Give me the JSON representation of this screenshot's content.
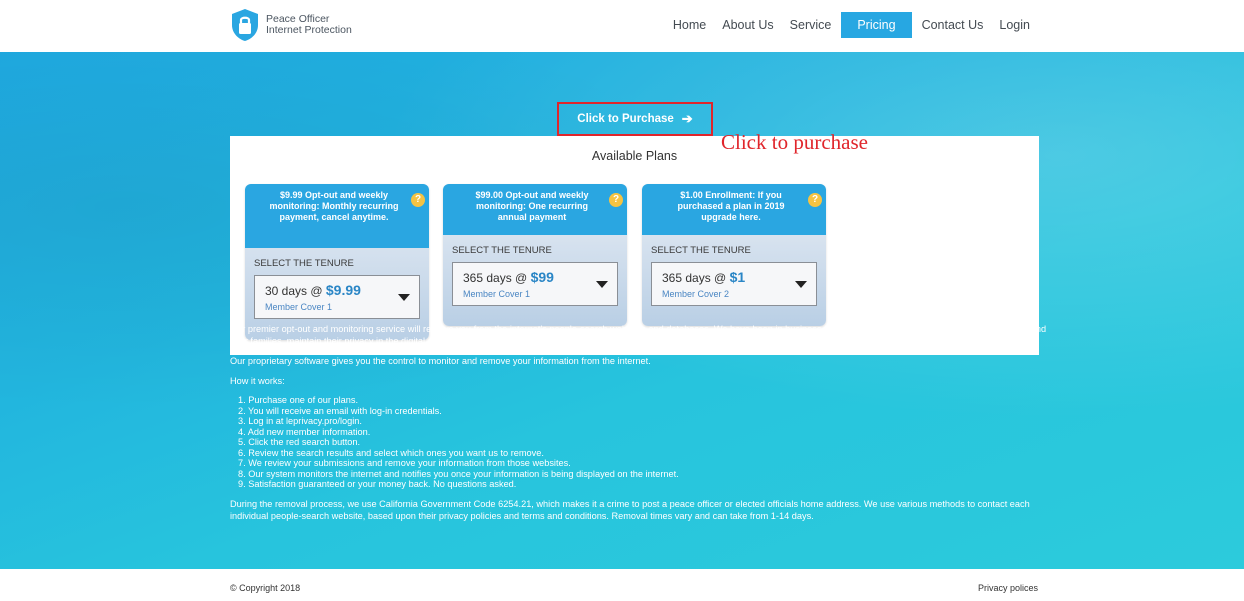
{
  "header": {
    "logo_line1": "Peace Officer",
    "logo_line2": "Internet Protection",
    "nav": [
      "Home",
      "About Us",
      "Service",
      "Pricing",
      "Contact Us",
      "Login"
    ],
    "active_nav": "Pricing"
  },
  "purchase": {
    "label": "Click to Purchase",
    "arrow": "➔",
    "annotation": "Click to purchase"
  },
  "plans": {
    "title": "Available Plans",
    "tenure_label": "SELECT THE TENURE",
    "help": "?",
    "items": [
      {
        "header": "$9.99 Opt-out and weekly monitoring: Monthly recurring payment, cancel anytime.",
        "duration": "30 days @",
        "price": "$9.99",
        "cover": "Member Cover 1"
      },
      {
        "header": "$99.00 Opt-out and weekly monitoring: One recurring annual payment",
        "duration": "365 days @",
        "price": "$99",
        "cover": "Member Cover 1"
      },
      {
        "header": "$1.00 Enrollment: If you purchased a plan in 2019 upgrade here.",
        "duration": "365 days @",
        "price": "$1",
        "cover": "Member Cover 2"
      }
    ]
  },
  "content": {
    "para1": "Our premier opt-out and monitoring service will remove you from the internet's people-search websites and databases. We have been in business for 10 years, helping members of law enforcement and their families, maintain their privacy in the digital age. Today, anyone can find out where you and your family lives with just your first and last name.",
    "para2": "Our proprietary software gives you the control to monitor and remove your information from the internet.",
    "how_title": "How it works:",
    "steps": [
      "1. Purchase one of our plans.",
      "2. You will receive an email with log-in credentials.",
      "3. Log in at leprivacy.pro/login.",
      "4. Add new member information.",
      "5. Click the red search button.",
      "6. Review the search results and select which ones you want us to remove.",
      "7. We review your submissions and remove your information from those websites.",
      "8. Our system monitors the internet and notifies you once your information is being displayed on the internet.",
      "9. Satisfaction guaranteed or your money back. No questions asked."
    ],
    "para3": "During the removal process, we use California Government Code 6254.21, which makes it a crime to post a peace officer or elected officials home address. We use various methods to contact each individual people-search website, based upon their privacy policies and terms and conditions. Removal times vary and can take from 1-14 days."
  },
  "footer": {
    "copyright": "© Copyright 2018",
    "privacy": "Privacy polices"
  },
  "colors": {
    "accent": "#27a7e2",
    "annotation_red": "#e0252b",
    "help_badge": "#f5c342"
  }
}
